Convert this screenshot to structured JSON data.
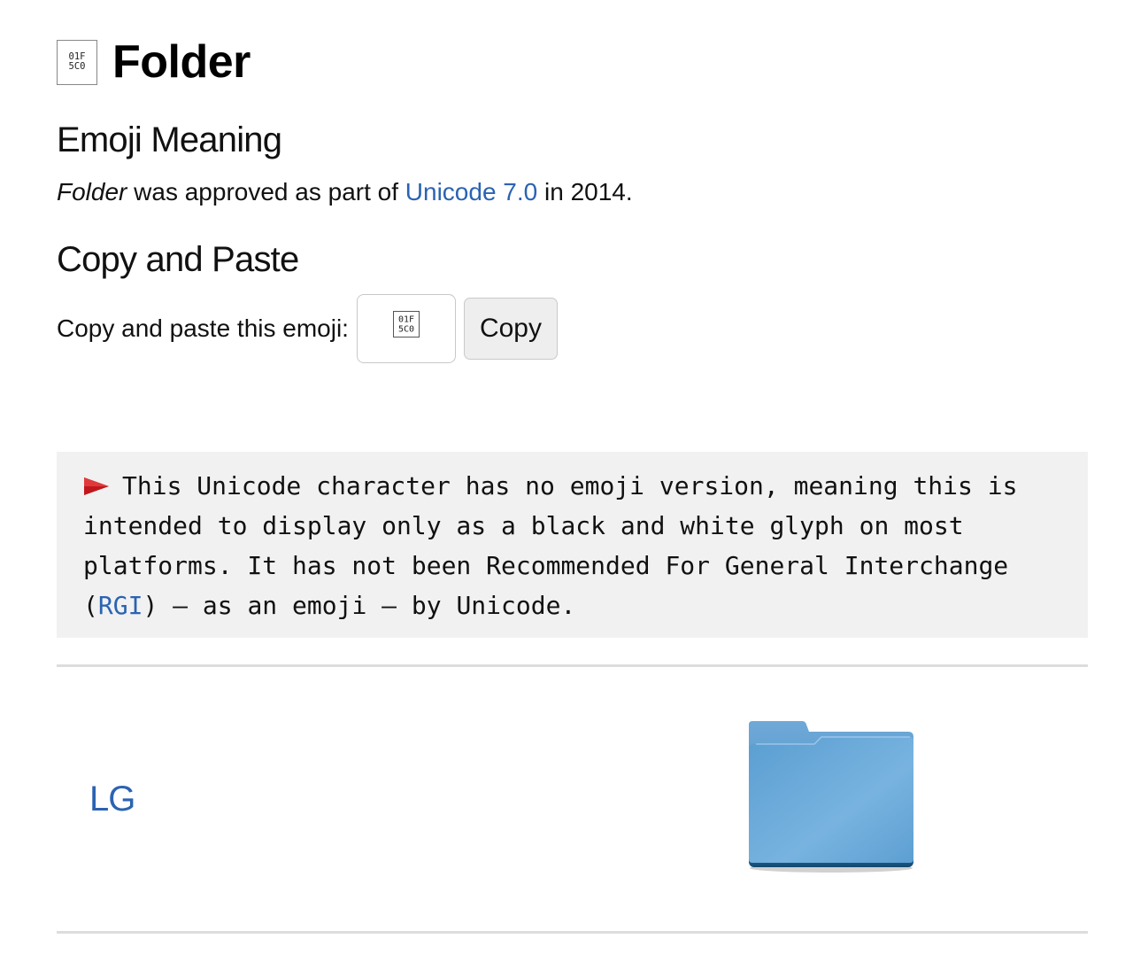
{
  "header": {
    "title": "Folder",
    "glyph_icon": "missing-glyph-icon",
    "glyph_text_top": "01F",
    "glyph_text_bottom": "5C0"
  },
  "meaning": {
    "heading": "Emoji Meaning",
    "name_italic": "Folder",
    "text_before_link": " was approved as part of ",
    "link_label": "Unicode 7.0",
    "text_after_link": " in 2014."
  },
  "copy_section": {
    "heading": "Copy and Paste",
    "label": "Copy and paste this emoji:",
    "field_value_icon": "missing-glyph-icon",
    "button_label": "Copy"
  },
  "notice": {
    "icon": "red-flag-icon",
    "text_before_link": "This Unicode character has no emoji version, meaning this is intended to display only as a black and white glyph on most platforms. It has not been Recommended For General Interchange (",
    "link_label": "RGI",
    "text_after_link": ") — as an emoji — by Unicode."
  },
  "vendors": [
    {
      "name": "LG",
      "image_icon": "folder-icon"
    }
  ],
  "colors": {
    "link": "#2a63b2",
    "notice_background": "#f1f1f1",
    "divider": "#dddddd",
    "flag": "#c0171c",
    "folder": "#5a9fd3"
  }
}
